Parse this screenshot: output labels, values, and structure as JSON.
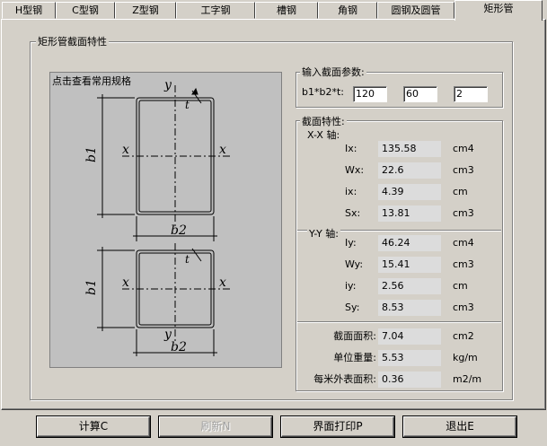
{
  "tabs": [
    "H型钢",
    "C型钢",
    "Z型钢",
    "工字钢",
    "槽钢",
    "角钢",
    "圆钢及圆管",
    "矩形管"
  ],
  "group_title": "矩形管截面特性",
  "diagram": {
    "hint": "点击查看常用规格",
    "labels": {
      "y": "y",
      "x": "x",
      "t": "t",
      "b1": "b1",
      "b2": "b2"
    }
  },
  "input_section": {
    "title": "输入截面参数:",
    "param_label": "b1*b2*t:",
    "b1": "120",
    "b2": "60",
    "t": "2"
  },
  "properties": {
    "title": "截面特性:",
    "xx_title": "X-X 轴:",
    "xx": [
      {
        "label": "Ix:",
        "value": "135.58",
        "unit": "cm4"
      },
      {
        "label": "Wx:",
        "value": "22.6",
        "unit": "cm3"
      },
      {
        "label": "ix:",
        "value": "4.39",
        "unit": "cm"
      },
      {
        "label": "Sx:",
        "value": "13.81",
        "unit": "cm3"
      }
    ],
    "yy_title": "Y-Y 轴:",
    "yy": [
      {
        "label": "Iy:",
        "value": "46.24",
        "unit": "cm4"
      },
      {
        "label": "Wy:",
        "value": "15.41",
        "unit": "cm3"
      },
      {
        "label": "iy:",
        "value": "2.56",
        "unit": "cm"
      },
      {
        "label": "Sy:",
        "value": "8.53",
        "unit": "cm3"
      }
    ],
    "summary": [
      {
        "label": "截面面积:",
        "value": "7.04",
        "unit": "cm2"
      },
      {
        "label": "单位重量:",
        "value": "5.53",
        "unit": "kg/m"
      },
      {
        "label": "每米外表面积:",
        "value": "0.36",
        "unit": "m2/m"
      }
    ]
  },
  "buttons": {
    "calc": "计算C",
    "refresh": "刷新N",
    "print": "界面打印P",
    "exit": "退出E"
  }
}
